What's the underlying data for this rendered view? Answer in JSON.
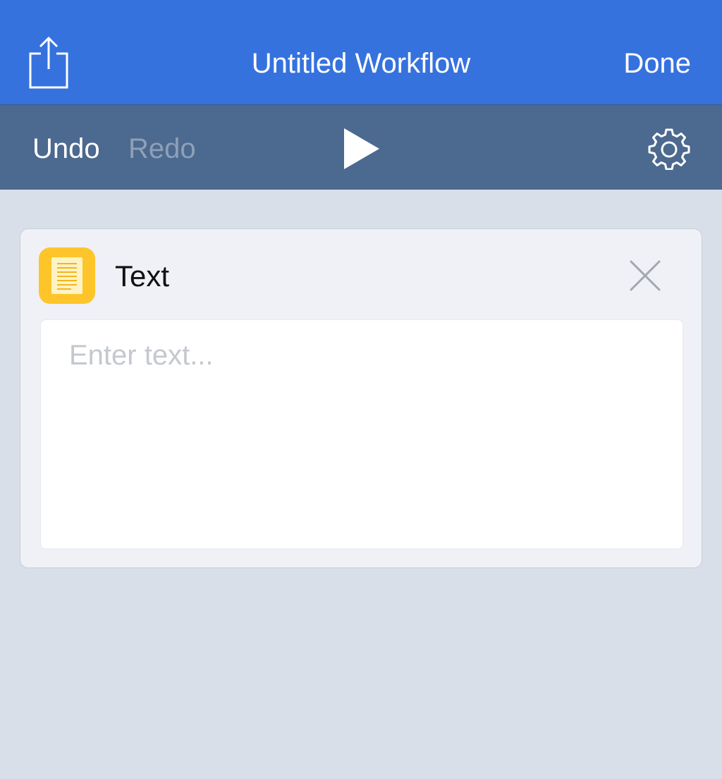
{
  "nav": {
    "title": "Untitled Workflow",
    "done_label": "Done",
    "share_icon": "share-icon"
  },
  "toolbar": {
    "undo_label": "Undo",
    "redo_label": "Redo",
    "play_icon": "play-icon",
    "settings_icon": "gear-icon"
  },
  "action": {
    "title": "Text",
    "icon": "text-document-icon",
    "icon_color": "#fdc52a",
    "placeholder": "Enter text...",
    "value": ""
  },
  "colors": {
    "navbar": "#3672de",
    "toolbar": "#4c698f",
    "background": "#d8dfe9",
    "redo_disabled": "#8ea0b8"
  }
}
